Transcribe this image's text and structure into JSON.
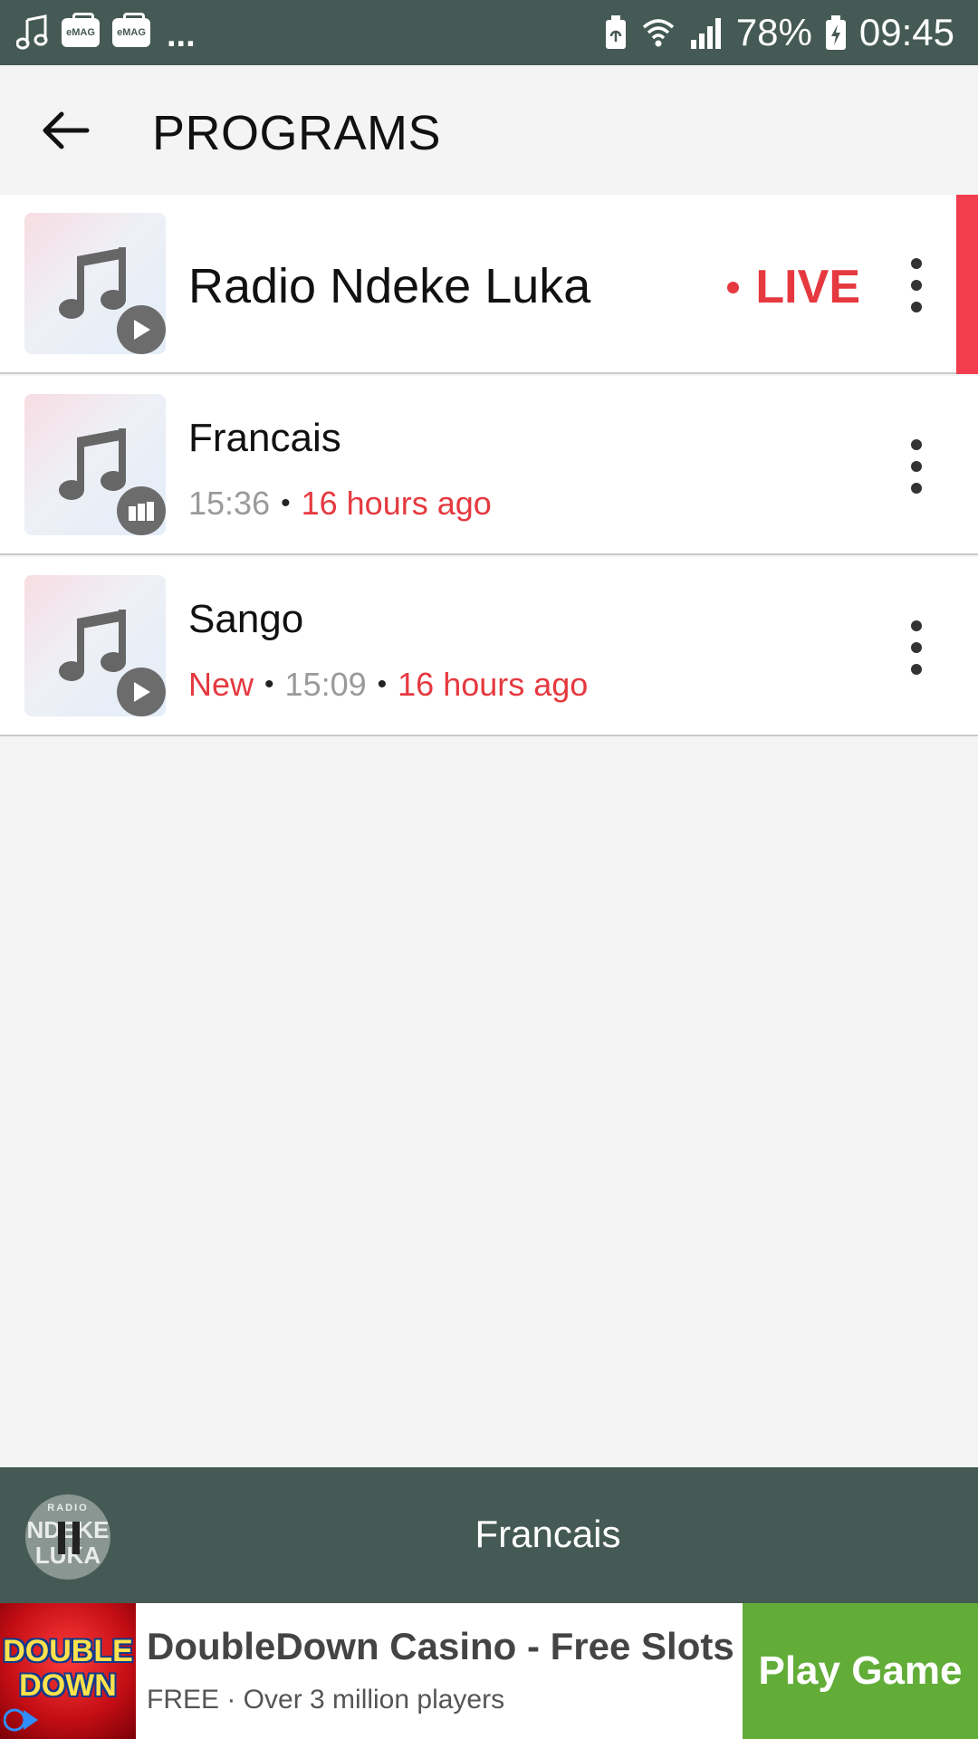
{
  "status_bar": {
    "battery": "78%",
    "time": "09:45",
    "overflow": "...",
    "emag_label": "eMAG",
    "icons": [
      "music-note-icon",
      "emag-icon",
      "emag-icon",
      "battery-saver-icon",
      "wifi-icon",
      "signal-icon",
      "battery-charging-icon"
    ]
  },
  "header": {
    "title": "PROGRAMS",
    "back_icon": "arrow-left-icon"
  },
  "programs": [
    {
      "title": "Radio Ndeke Luka",
      "status": "LIVE",
      "badge_icon": "play-icon",
      "menu_icon": "more-vertical-icon"
    },
    {
      "title": "Francais",
      "duration": "15:36",
      "separator": "•",
      "age": "16 hours ago",
      "badge_icon": "now-playing-bars-icon",
      "menu_icon": "more-vertical-icon"
    },
    {
      "title": "Sango",
      "tag": "New",
      "duration": "15:09",
      "separator": "•",
      "age": "16 hours ago",
      "badge_icon": "play-icon",
      "menu_icon": "more-vertical-icon"
    }
  ],
  "player": {
    "now_playing": "Francais",
    "logo_line1": "RADIO",
    "logo_line2": "NDEKE",
    "logo_line3": "LUKA",
    "control_icon": "pause-icon"
  },
  "ad": {
    "logo_line1": "DOUBLE",
    "logo_line2": "DOWN",
    "title": "DoubleDown Casino - Free Slots",
    "subtitle": "FREE · Over 3 million players",
    "cta": "Play Game"
  },
  "colors": {
    "status_bar": "#455a54",
    "accent_red": "#e5393f",
    "live_strip": "#f33c4d",
    "cta_green": "#62ad38",
    "background": "#f4f4f4"
  }
}
